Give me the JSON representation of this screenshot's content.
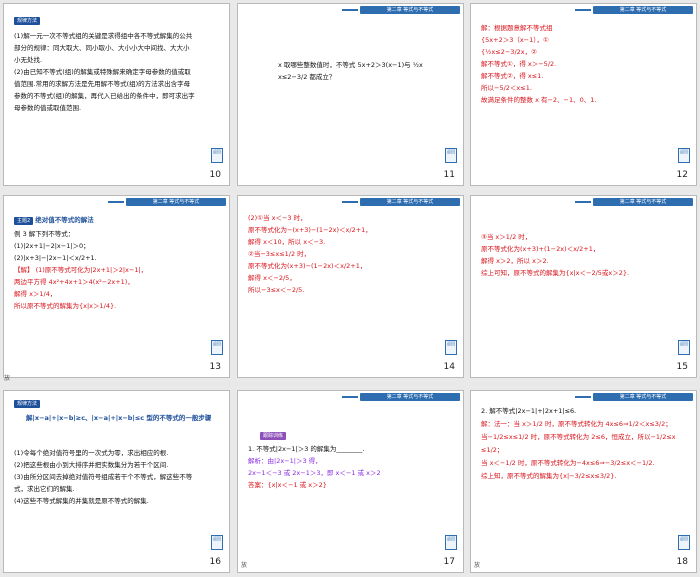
{
  "header_label": "第二章 等式与不等式",
  "back_label": "返回",
  "play_label": "放",
  "slides": [
    {
      "num": "10",
      "tag": "规律方法",
      "lines": [
        "(1)解一元一次不等式组的关键是求得组中各不等式解集的公共",
        "部分的规律：同大取大、同小取小、大小小大中间找、大大小",
        "小无处找.",
        "(2)由已知不等式(组)的解集或特殊解来确定字母参数的值或取",
        "值范围.常用的求解方法是先用解不等式(组)的方法求出含字母",
        "参数的不等式(组)的解集，再代入已给出的条件中，即可求出字",
        "母参数的值或取值范围."
      ]
    },
    {
      "num": "11",
      "lines": [
        "x 取哪些整数值时，不等式 5x+2＞3(x−1)与 ½x",
        "x≤2−3/2 都成立？"
      ]
    },
    {
      "num": "12",
      "lines": [
        "解：根据题意解不等式组",
        "{5x+2＞3（x−1），①",
        "{½x≤2−3/2x，②",
        "解不等式①，得 x＞−5/2.",
        "解不等式②，得 x≤1.",
        "所以−5/2＜x≤1.",
        "故满足条件的整数 x 有−2、−1、0、1."
      ]
    },
    {
      "num": "13",
      "tag": "主题2",
      "title": "绝对值不等式的解法",
      "lines": [
        "例 3  解下列不等式：",
        "(1)|2x+1|−2|x−1|＞0；",
        "(2)|x+3|−|2x−1|＜x/2+1.",
        "【解】 (1)原不等式可化为|2x+1|＞2|x−1|，",
        "两边平方得 4x²+4x+1＞4(x²−2x+1)，",
        "解得 x＞1/4，",
        "所以原不等式的解集为{x|x＞1/4}."
      ]
    },
    {
      "num": "14",
      "lines": [
        "(2)①当 x＜−3 时，",
        "原不等式化为−(x+3)−(1−2x)＜x/2+1，",
        "解得 x＜10，所以 x＜−3.",
        "②当−3≤x≤1/2 时，",
        "原不等式化为(x+3)−(1−2x)＜x/2+1，",
        "解得 x＜−2/5，",
        "所以−3≤x＜−2/5."
      ]
    },
    {
      "num": "15",
      "lines": [
        "③当 x＞1/2 时，",
        "原不等式化为(x+3)+(1−2x)＜x/2+1，",
        "解得 x＞2，所以 x＞2.",
        "综上可知，原不等式的解集为{x|x＜−2/5或x＞2}."
      ]
    },
    {
      "num": "16",
      "tag": "规律方法",
      "subtitle": "解|x−a|+|x−b|≥c、|x−a|+|x−b|≤c 型的不等式的一般步骤",
      "lines": [
        "(1)令每个绝对值符号里的一次式为零，求出相应的根.",
        "(2)把这些根由小到大排序并把实数集分为若干个区间.",
        "(3)由所分区间去掉绝对值符号组成若干个不等式，解这些不等",
        "式，求出它们的解集.",
        "(4)这些不等式解集的并集就是原不等式的解集."
      ]
    },
    {
      "num": "17",
      "tag": "跟踪训练",
      "lines": [
        "1. 不等式|2x−1|＞3 的解集为________.",
        "解析：由|2x−1|＞3 得，",
        "2x−1＜−3 或 2x−1＞3，即 x＜−1 或 x＞2",
        "答案：{x|x＜−1 或 x＞2}"
      ]
    },
    {
      "num": "18",
      "lines": [
        "2. 解不等式|2x−1|+|2x+1|≤6.",
        "解：法一：当 x＞1/2 时，原不等式转化为 4x≤6⇒1/2＜x≤3/2；",
        "当−1/2≤x≤1/2 时，原不等式转化为 2≤6，恒成立，所以−1/2≤x",
        "≤1/2；",
        "当 x＜−1/2 时，原不等式转化为−4x≤6⇒−3/2≤x＜−1/2.",
        "综上知，原不等式的解集为{x|−3/2≤x≤3/2}."
      ]
    }
  ]
}
